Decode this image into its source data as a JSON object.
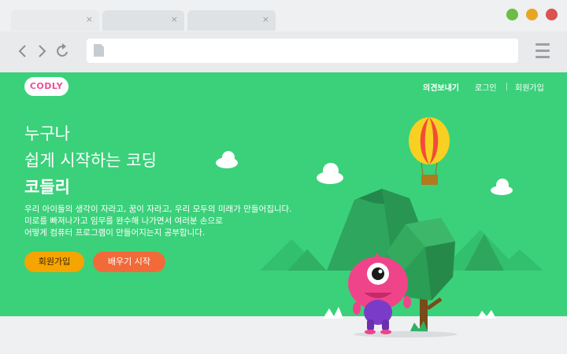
{
  "browser": {
    "tabs": [
      {
        "close": "×"
      },
      {
        "close": "×"
      },
      {
        "close": "×"
      }
    ],
    "window_controls": {
      "green": "#6bbd45",
      "yellow": "#e8a521",
      "red": "#d9534f"
    },
    "nav_icons": [
      "back-icon",
      "forward-icon",
      "reload-icon"
    ],
    "address": "",
    "menu_icon": "hamburger-menu-icon"
  },
  "site": {
    "logo_text": "CODLY",
    "nav": [
      {
        "label": "의견보내기"
      },
      {
        "label": "로그인"
      },
      {
        "label": "회원가입"
      }
    ]
  },
  "hero": {
    "line1": "누구나",
    "line2": "쉽게 시작하는 코딩",
    "line3": "코들리",
    "desc1": "우리 아이들의 생각이 자라고, 꿈이 자라고, 우리 모두의 미래가 만들어집니다.",
    "desc2": "미로를 빠져나가고 임무를 완수해 나가면서 여러분 손으로",
    "desc3": "어떻게 컴퓨터 프로그램이 만들어지는지 공부합니다.",
    "signup_button": "회원가입",
    "learn_button": "배우기 시작"
  },
  "colors": {
    "page_green": "#3ad17a",
    "button_yellow": "#f6a400",
    "button_orange": "#f26a3a",
    "monster_pink": "#f0448a"
  }
}
